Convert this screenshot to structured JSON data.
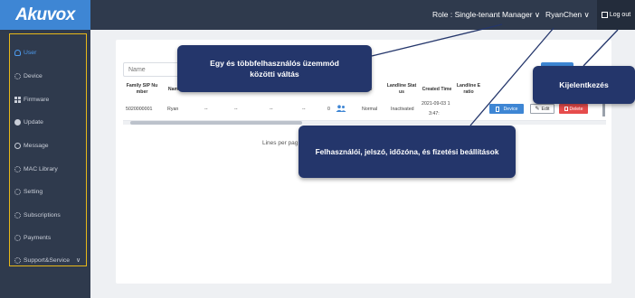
{
  "header": {
    "logo": "Akuvox",
    "role_label": "Role : Single-tenant Manager ∨",
    "user_label": "RyanChen ∨",
    "logout_label": "Log out"
  },
  "sidebar": {
    "items": [
      {
        "label": "User",
        "icon": "user-icon",
        "active": true
      },
      {
        "label": "Device",
        "icon": "gear-icon"
      },
      {
        "label": "Firmware",
        "icon": "grid-icon"
      },
      {
        "label": "Update",
        "icon": "update-icon"
      },
      {
        "label": "Message",
        "icon": "message-icon"
      },
      {
        "label": "MAC Library",
        "icon": "gear-icon"
      },
      {
        "label": "Setting",
        "icon": "gear-icon"
      },
      {
        "label": "Subscriptions",
        "icon": "gear-icon"
      },
      {
        "label": "Payments",
        "icon": "gear-icon"
      },
      {
        "label": "Support&Service",
        "icon": "gear-icon"
      }
    ],
    "chevron": "∨",
    "highlight_color": "#e8b819"
  },
  "search": {
    "placeholder": "Name"
  },
  "table": {
    "headers": {
      "sip": [
        "Family SIP Nu",
        "mber"
      ],
      "name": "Name",
      "landline_status": [
        "Landline Stat",
        "us"
      ],
      "created_time": "Created Time",
      "landline_e": [
        "Landline E",
        "ratio"
      ],
      "status_e": "e"
    },
    "row": {
      "sip": "5020000001",
      "name": "Ryan",
      "d1": "--",
      "d2": "--",
      "d3": "--",
      "d4": "--",
      "count": "0",
      "status": "Normal",
      "landline_status": "Inactivated",
      "created_date": "2021-09-03 1",
      "created_time": "3:47:"
    },
    "actions": {
      "device": "Device",
      "edit": "Edit",
      "delete": "Delete"
    },
    "pagination": "Lines per pag"
  },
  "callouts": {
    "switch": "Egy és többfelhasználós üzemmód\nközötti váltás",
    "logout": "Kijelentkezés",
    "settings": "Felhasználói, jelszó, időzóna, és fizetési beállítások"
  },
  "colors": {
    "accent": "#3e86d4",
    "sidebar_bg": "#2f3a4d",
    "callout_bg": "#24366b",
    "danger": "#e64c4c"
  }
}
